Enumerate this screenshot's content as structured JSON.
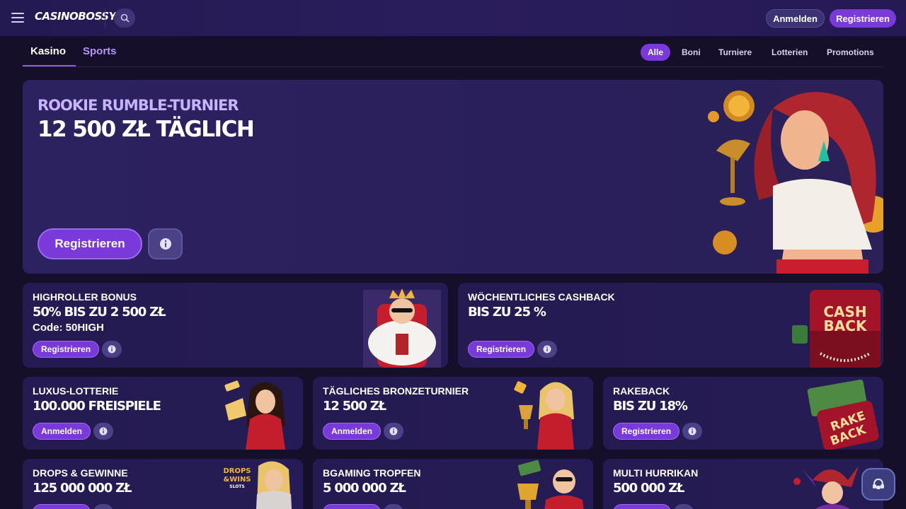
{
  "header": {
    "logo": "CASINOBOSSY",
    "login_label": "Anmelden",
    "register_label": "Registrieren"
  },
  "tabs": {
    "main": [
      "Kasino",
      "Sports"
    ],
    "filters": [
      "Alle",
      "Boni",
      "Turniere",
      "Lotterien",
      "Promotions"
    ],
    "active_filter": "Alle"
  },
  "hero": {
    "subtitle": "Rookie Rumble-Turnier",
    "title": "12 500 zł täglich",
    "register_label": "Registrieren"
  },
  "cards": [
    {
      "title": "HIGHROLLER BONUS",
      "value": "50% bis zu 2 500 zł",
      "code": "Code: 50HIGH",
      "button": "Registrieren"
    },
    {
      "title": "WÖCHENTLICHES CASHBACK",
      "value": "bis zu 25 %",
      "button": "Registrieren",
      "art_text": [
        "CASH",
        "BACK"
      ]
    },
    {
      "title": "LUXUS-LOTTERIE",
      "value": "100.000 Freispiele",
      "button": "Anmelden"
    },
    {
      "title": "TÄGLICHES BRONZETURNIER",
      "value": "12 500 zł",
      "button": "Anmelden"
    },
    {
      "title": "RAKEBACK",
      "value": "bis zu 18%",
      "button": "Registrieren",
      "art_text": [
        "RAKE",
        "BACK"
      ]
    },
    {
      "title": "DROPS & GEWINNE",
      "value": "125 000 000 zł",
      "button": "",
      "art_text": [
        "DROPS",
        "&WINS",
        "SLOTS"
      ]
    },
    {
      "title": "BGAMING TROPFEN",
      "value": "5 000 000 zł",
      "button": ""
    },
    {
      "title": "MULTI HURRIKAN",
      "value": "500 000 zł",
      "button": ""
    }
  ],
  "colors": {
    "accent": "#7a3ad9",
    "background": "#150f29",
    "card": "#261c55"
  }
}
